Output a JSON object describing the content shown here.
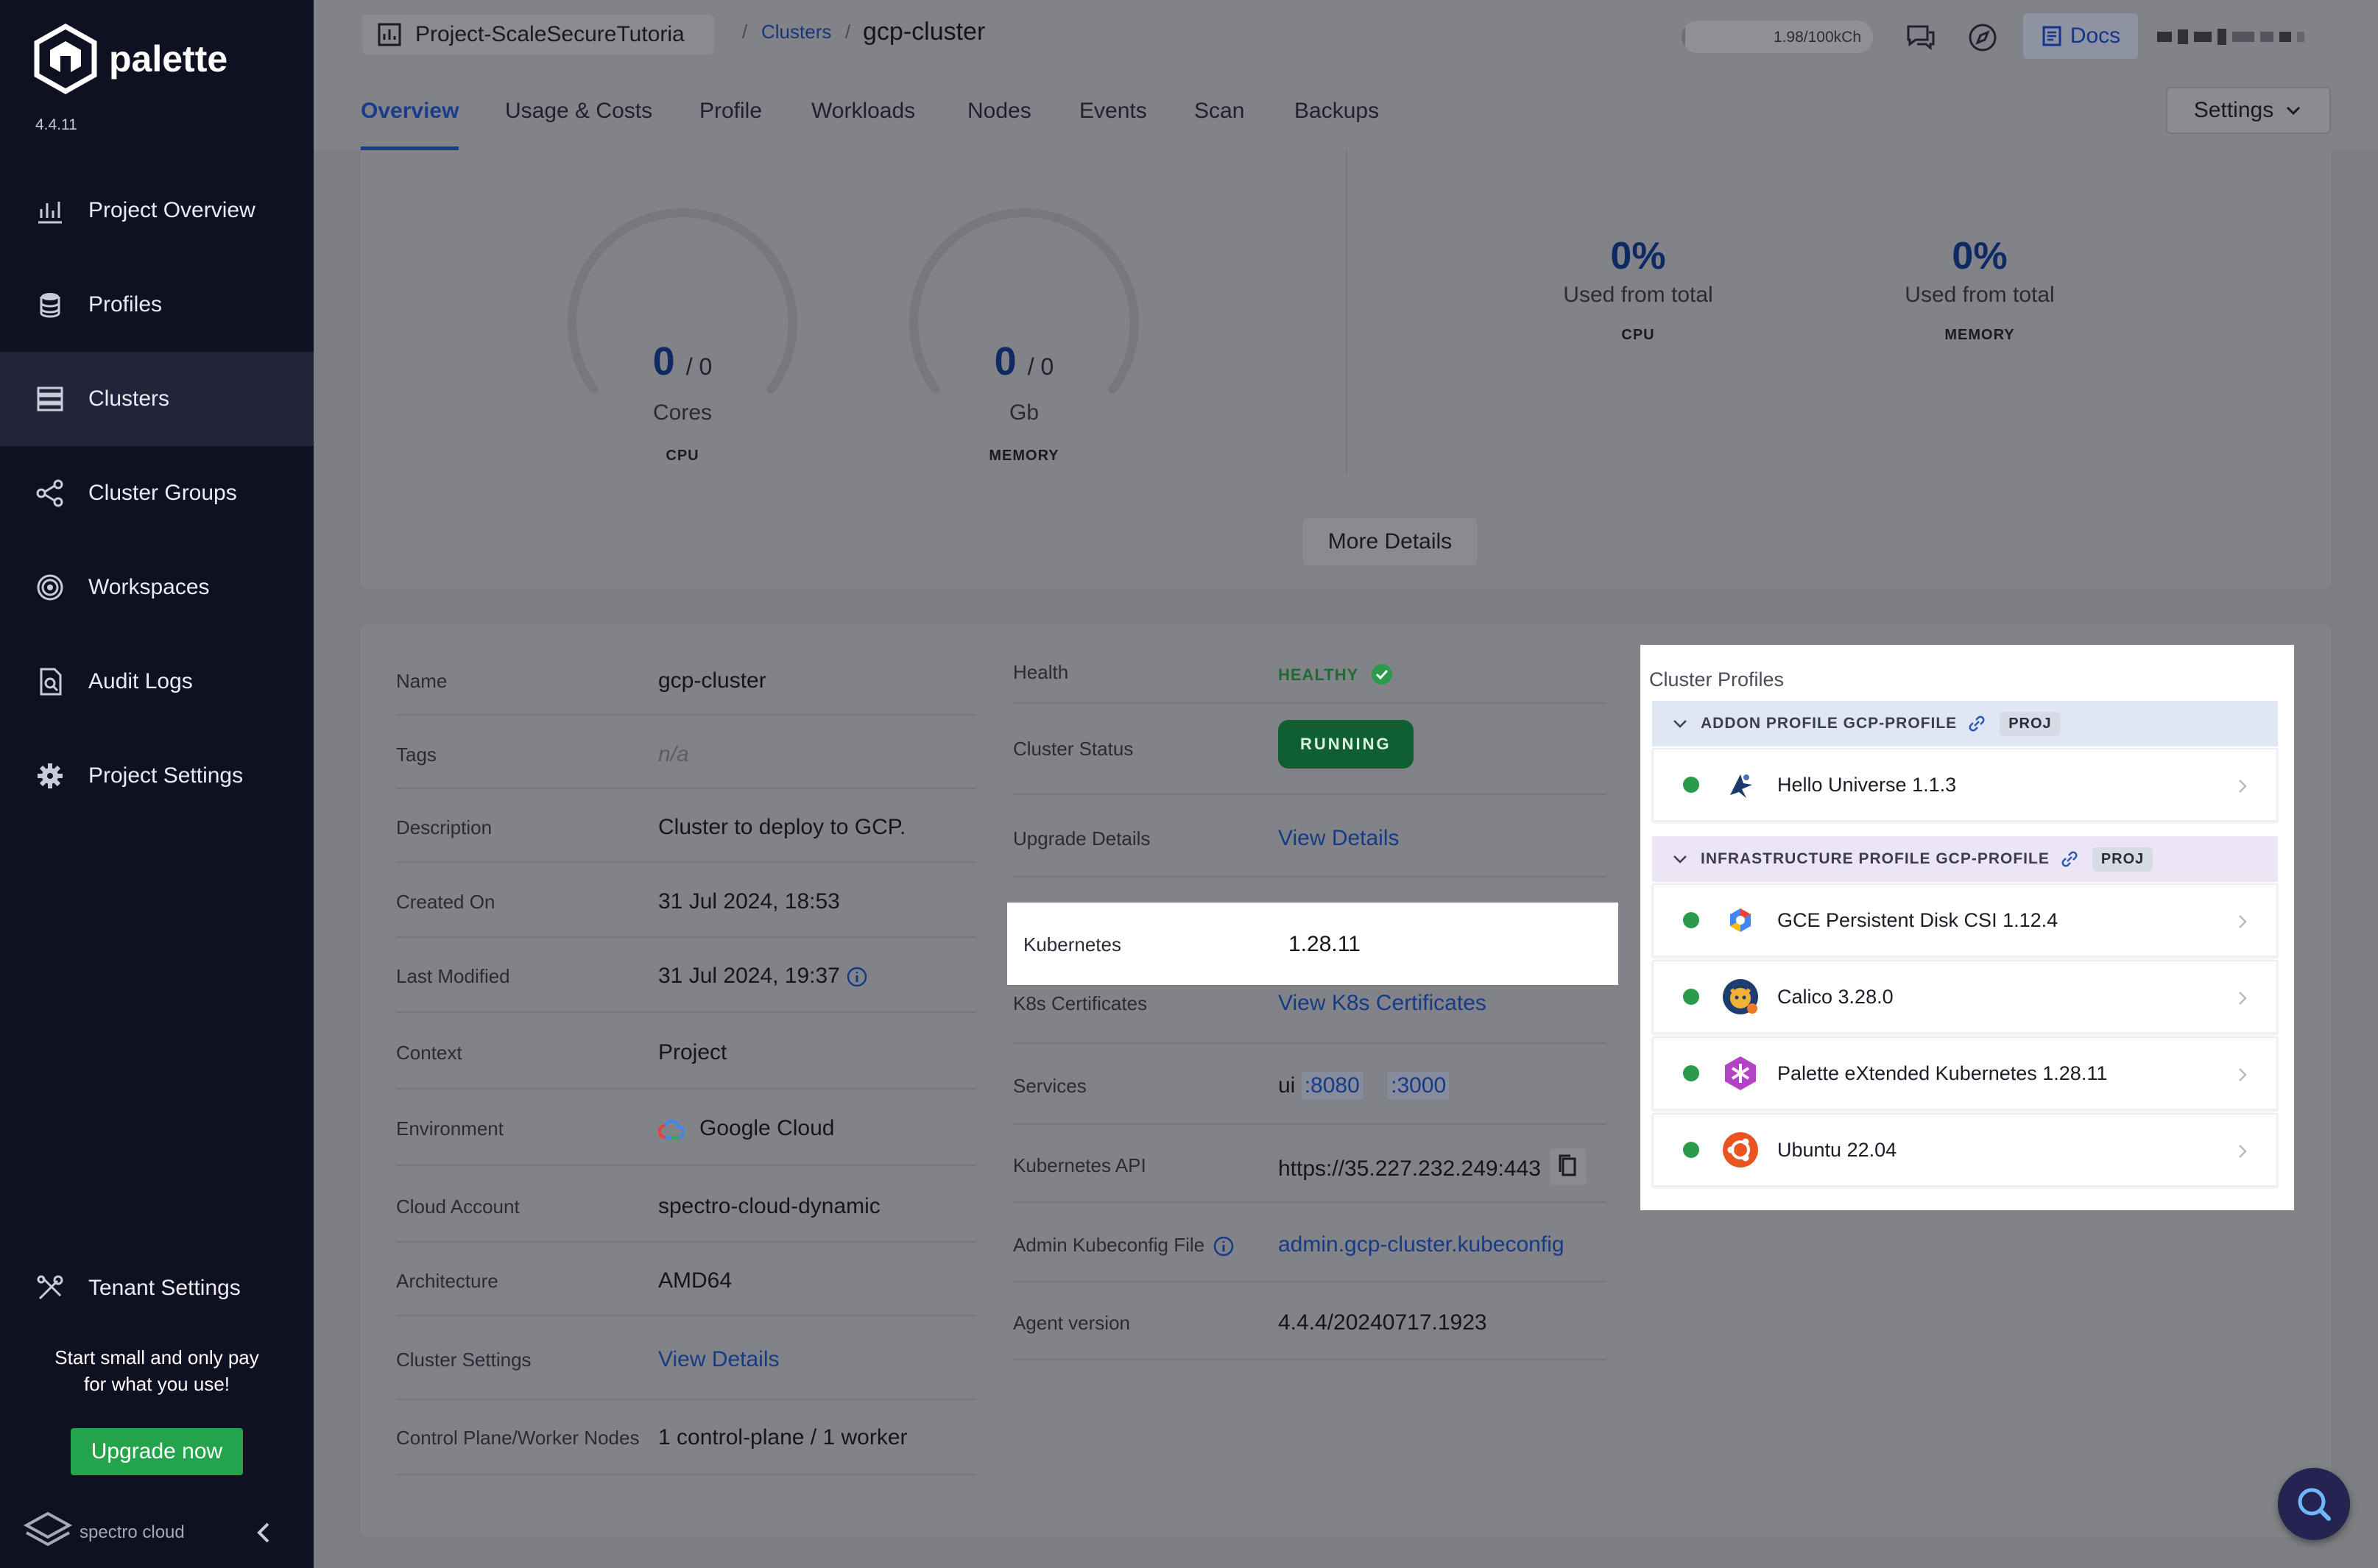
{
  "app": {
    "name": "palette",
    "version": "4.4.11"
  },
  "sidebar": {
    "items": [
      {
        "label": "Project Overview",
        "icon": "chart-icon"
      },
      {
        "label": "Profiles",
        "icon": "database-icon"
      },
      {
        "label": "Clusters",
        "icon": "server-icon",
        "active": true
      },
      {
        "label": "Cluster Groups",
        "icon": "network-icon"
      },
      {
        "label": "Workspaces",
        "icon": "target-icon"
      },
      {
        "label": "Audit Logs",
        "icon": "search-doc-icon"
      },
      {
        "label": "Project Settings",
        "icon": "gear-icon"
      }
    ],
    "tenant_settings": "Tenant Settings",
    "promo_line1": "Start small and only pay",
    "promo_line2": "for what you use!",
    "upgrade_label": "Upgrade now",
    "brand": "spectro cloud"
  },
  "topbar": {
    "project": "Project-ScaleSecureTutoria",
    "breadcrumb_link": "Clusters",
    "breadcrumb_current": "gcp-cluster",
    "credits": "1.98/100kCh",
    "credits_fraction": 0.02,
    "docs": "Docs"
  },
  "tabs": [
    "Overview",
    "Usage & Costs",
    "Profile",
    "Workloads",
    "Nodes",
    "Events",
    "Scan",
    "Backups"
  ],
  "settings_label": "Settings",
  "usage": {
    "cpu": {
      "value": "0",
      "total": "/ 0",
      "unit": "Cores",
      "label": "CPU"
    },
    "memory": {
      "value": "0",
      "total": "/ 0",
      "unit": "Gb",
      "label": "MEMORY"
    },
    "cpu_pct": {
      "value": "0%",
      "sub": "Used from total",
      "label": "CPU"
    },
    "memory_pct": {
      "value": "0%",
      "sub": "Used from total",
      "label": "MEMORY"
    },
    "more_details": "More Details"
  },
  "details_left": [
    {
      "label": "Name",
      "value": "gcp-cluster"
    },
    {
      "label": "Tags",
      "value": "n/a"
    },
    {
      "label": "Description",
      "value": "Cluster to deploy to GCP."
    },
    {
      "label": "Created On",
      "value": "31 Jul 2024, 18:53"
    },
    {
      "label": "Last Modified",
      "value": "31 Jul 2024, 19:37"
    },
    {
      "label": "Context",
      "value": "Project"
    },
    {
      "label": "Environment",
      "value": "Google Cloud"
    },
    {
      "label": "Cloud Account",
      "value": "spectro-cloud-dynamic"
    },
    {
      "label": "Architecture",
      "value": "AMD64"
    },
    {
      "label": "Cluster Settings",
      "value": "View Details"
    },
    {
      "label": "Control Plane/Worker Nodes",
      "value": "1 control-plane / 1 worker"
    }
  ],
  "details_right": {
    "health_label": "Health",
    "health_value": "HEALTHY",
    "status_label": "Cluster Status",
    "status_value": "RUNNING",
    "upgrade_label": "Upgrade Details",
    "upgrade_value": "View Details",
    "k8s_label": "Kubernetes",
    "k8s_value": "1.28.11",
    "certs_label": "K8s Certificates",
    "certs_value": "View K8s Certificates",
    "services_label": "Services",
    "services_prefix": "ui",
    "service_port1": ":8080",
    "service_port2": ":3000",
    "api_label": "Kubernetes API",
    "api_value": "https://35.227.232.249:443",
    "kubeconfig_label": "Admin Kubeconfig File",
    "kubeconfig_value": "admin.gcp-cluster.kubeconfig",
    "agent_label": "Agent version",
    "agent_value": "4.4.4/20240717.1923"
  },
  "cluster_profiles": {
    "title": "Cluster Profiles",
    "addon_group": "ADDON PROFILE GCP-PROFILE",
    "infra_group": "INFRASTRUCTURE PROFILE GCP-PROFILE",
    "badge": "PROJ",
    "addon_items": [
      "Hello Universe 1.1.3"
    ],
    "infra_items": [
      "GCE Persistent Disk CSI 1.12.4",
      "Calico 3.28.0",
      "Palette eXtended Kubernetes 1.28.11",
      "Ubuntu 22.04"
    ]
  },
  "colors": {
    "accent": "#1a3c8a",
    "healthy": "#2b9a4b",
    "running": "#0f5f33",
    "sidebar": "#0f1122"
  }
}
